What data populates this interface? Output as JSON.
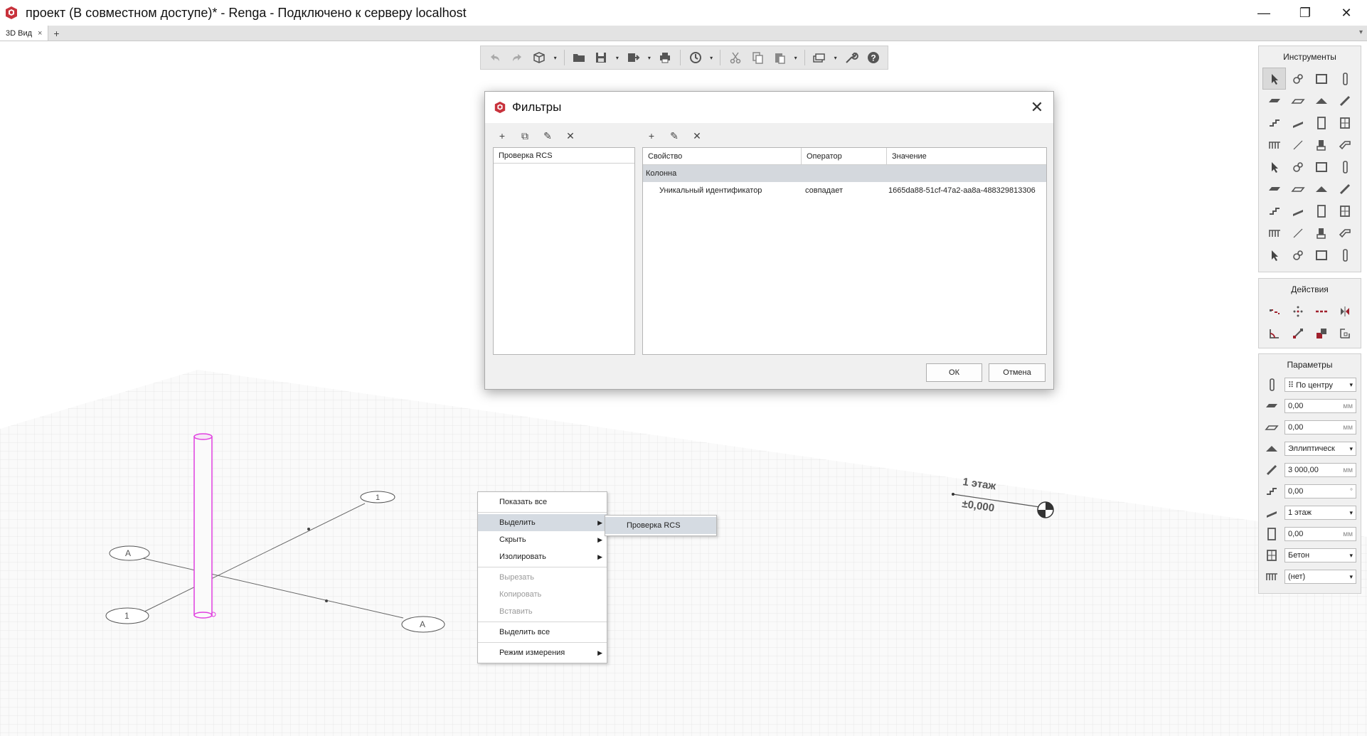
{
  "window": {
    "title": "проект (В совместном доступе)* - Renga - Подключено к серверу localhost",
    "minimize": "—",
    "maximize": "❐",
    "close": "✕"
  },
  "tabs": [
    {
      "label": "3D Вид",
      "close": "×"
    }
  ],
  "tab_add": "+",
  "tab_menu": "▾",
  "main_toolbar": {
    "icons": [
      "undo-icon",
      "redo-icon",
      "view-cube-icon",
      "open-folder-icon",
      "save-icon",
      "export-icon",
      "print-icon",
      "sync-icon",
      "cut-icon",
      "copy-icon",
      "paste-icon",
      "layers-icon",
      "settings-wrench-icon",
      "help-icon"
    ],
    "dropdown_arrow": "▾"
  },
  "panels": {
    "tools": {
      "title": "Инструменты",
      "icons": [
        "select-icon",
        "assembly-icon",
        "wall-icon",
        "column-icon",
        "floor-icon",
        "slab-icon",
        "roof-icon",
        "beam-icon",
        "stair-icon",
        "ramp-icon",
        "door-icon",
        "window-icon",
        "railing-icon",
        "line-icon",
        "equipment-icon",
        "pipe-icon",
        "fixture-icon",
        "plumbing-icon",
        "valve-icon",
        "duct-icon",
        "mechanical-icon",
        "accessory-icon",
        "outlet-icon",
        "cable-icon",
        "system-icon",
        "lamp-icon",
        "electrical-icon",
        "panel-icon",
        "room-icon",
        "element-icon",
        "opening-icon",
        "rebar-icon",
        "dimension-icon",
        "axis-icon",
        "hatch-icon",
        "text-icon"
      ]
    },
    "actions": {
      "title": "Действия",
      "icons": [
        "move-icon",
        "rotate-icon",
        "copy-linear-icon",
        "mirror-icon",
        "align-icon",
        "stretch-icon",
        "delete-icon",
        "offset-icon"
      ]
    },
    "params": {
      "title": "Параметры",
      "rows": [
        {
          "icon": "placement-icon",
          "value": "По центру",
          "kind": "select",
          "prefix": "⠿"
        },
        {
          "icon": "offset-x-icon",
          "value": "0,00",
          "unit": "мм",
          "kind": "input"
        },
        {
          "icon": "offset-y-icon",
          "value": "0,00",
          "unit": "мм",
          "kind": "input"
        },
        {
          "icon": "profile-icon",
          "value": "Эллиптическ",
          "kind": "select"
        },
        {
          "icon": "height-icon",
          "value": "3 000,00",
          "unit": "мм",
          "kind": "input"
        },
        {
          "icon": "angle-icon",
          "value": "0,00",
          "unit": "°",
          "kind": "input"
        },
        {
          "icon": "level-icon",
          "value": "1 этаж",
          "kind": "select"
        },
        {
          "icon": "level-offset-icon",
          "value": "0,00",
          "unit": "мм",
          "kind": "input"
        },
        {
          "icon": "material-icon",
          "value": "Бетон",
          "kind": "select"
        },
        {
          "icon": "mark-icon",
          "value": "(нет)",
          "kind": "select"
        }
      ]
    }
  },
  "dialog": {
    "title": "Фильтры",
    "close": "✕",
    "left_tools": [
      "+",
      "⧉",
      "✎",
      "✕"
    ],
    "right_tools": [
      "+",
      "✎",
      "✕"
    ],
    "filters": [
      "Проверка RCS"
    ],
    "columns": [
      "Свойство",
      "Оператор",
      "Значение"
    ],
    "group": "Колонна",
    "rows": [
      {
        "property": "Уникальный идентификатор",
        "operator": "совпадает",
        "value": "1665da88-51cf-47a2-aa8a-488329813306"
      }
    ],
    "ok": "ОК",
    "cancel": "Отмена"
  },
  "context_menu": {
    "items": [
      {
        "label": "Показать все",
        "enabled": true
      },
      {
        "label": "Выделить",
        "enabled": true,
        "submenu": true,
        "highlighted": true
      },
      {
        "label": "Скрыть",
        "enabled": true,
        "submenu": true
      },
      {
        "label": "Изолировать",
        "enabled": true,
        "submenu": true
      },
      {
        "label": "Вырезать",
        "enabled": false
      },
      {
        "label": "Копировать",
        "enabled": false
      },
      {
        "label": "Вставить",
        "enabled": false
      },
      {
        "label": "Выделить все",
        "enabled": true
      },
      {
        "label": "Режим измерения",
        "enabled": true,
        "submenu": true
      }
    ],
    "submenu_arrow": "▶",
    "submenu": {
      "items": [
        "Проверка RCS"
      ]
    }
  },
  "scene": {
    "level_name": "1 этаж",
    "level_elevation": "±0,000",
    "axis_labels": [
      "А",
      "1",
      "1",
      "А"
    ],
    "colors": {
      "selection": "#e040e0",
      "grid": "#dcdcdc",
      "axis": "#555555"
    }
  }
}
